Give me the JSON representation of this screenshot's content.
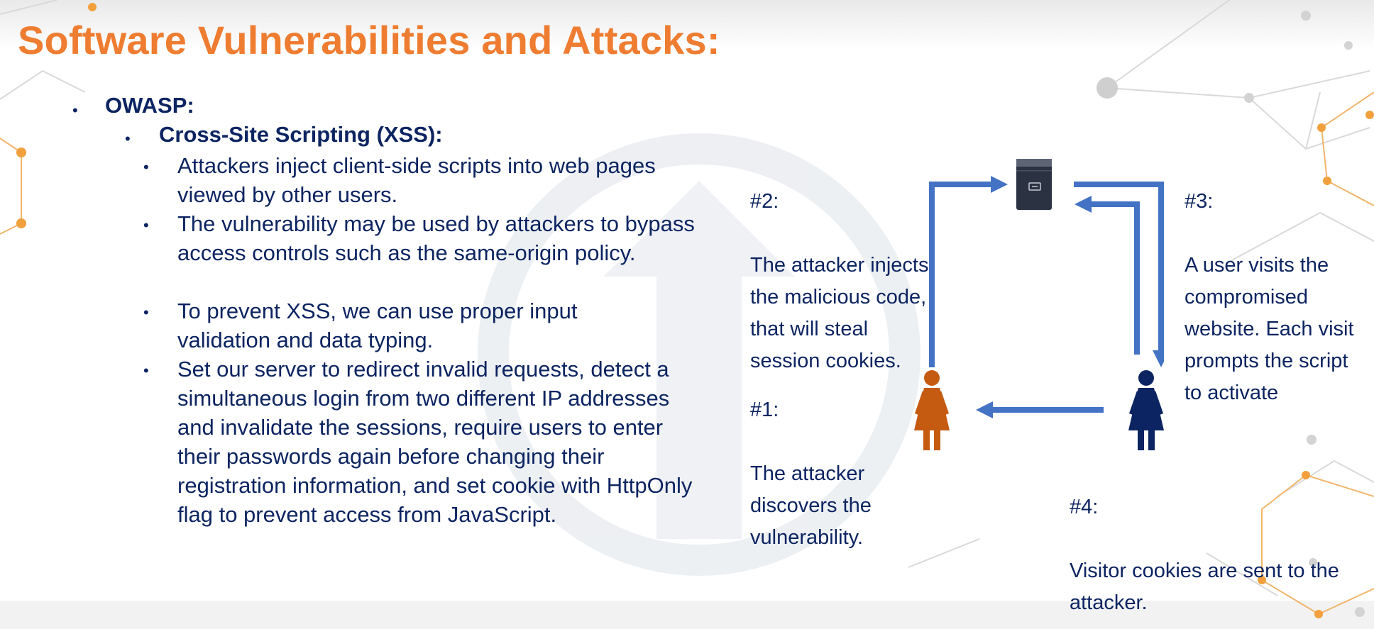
{
  "slide": {
    "title": "Software Vulnerabilities and Attacks:",
    "accent_color": "#ee7d31",
    "text_color": "#0c2461",
    "arrow_color": "#4472c4"
  },
  "content": {
    "level1": "OWASP:",
    "level2": "Cross-Site Scripting (XSS):",
    "items": [
      "Attackers inject client-side scripts into web pages viewed by other users.",
      "The vulnerability may be used by attackers to bypass access controls such as the same-origin policy.",
      "To prevent XSS, we can use proper input validation and data typing.",
      "Set our server to redirect invalid requests, detect a simultaneous login from two different IP addresses and invalidate the sessions, require users to enter their passwords again before changing their registration information, and set cookie with HttpOnly flag to prevent access from JavaScript."
    ]
  },
  "diagram": {
    "step2_num": "#2:",
    "step2_text": "The attacker injects the malicious code, that will steal session cookies.",
    "step1_num": "#1:",
    "step1_text": "The attacker discovers the vulnerability.",
    "step3_num": "#3:",
    "step3_text": "A user visits the compromised website. Each visit prompts the script to activate",
    "step4_num": "#4:",
    "step4_text": "Visitor cookies are sent to the attacker.",
    "icons": [
      "server-icon",
      "attacker-person-icon",
      "user-person-icon"
    ]
  }
}
